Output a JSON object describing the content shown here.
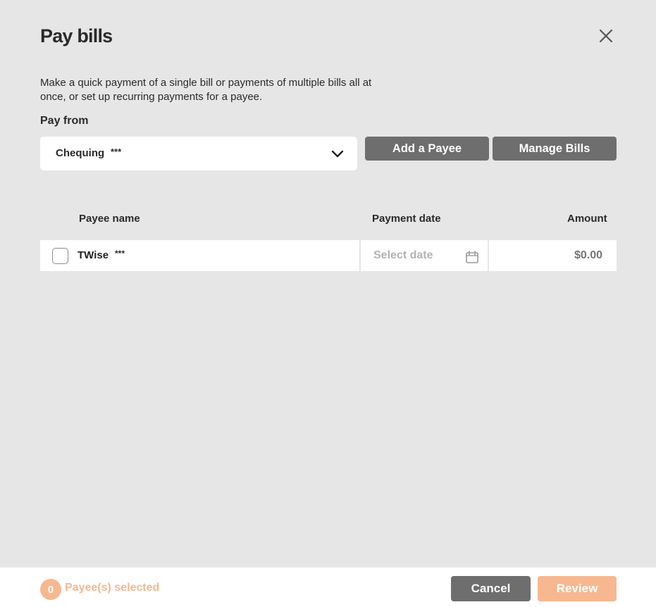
{
  "dialog": {
    "title": "Pay bills",
    "close_icon": "close-icon",
    "description": "Make a quick payment of a single bill or payments of multiple bills all at once, or set up recurring payments for a payee."
  },
  "pay_from": {
    "label": "Pay from",
    "selected_account": "Chequing",
    "account_mask": "***",
    "dropdown_icon": "chevron-down-icon"
  },
  "actions": {
    "add_payee_label": "Add a Payee",
    "manage_bills_label": "Manage Bills"
  },
  "table": {
    "headers": {
      "payee": "Payee name",
      "date": "Payment date",
      "amount": "Amount"
    },
    "rows": [
      {
        "checked": false,
        "payee_name": "TWise",
        "payee_mask": "***",
        "date_placeholder": "Select date",
        "date_icon": "calendar-icon",
        "amount_placeholder": "$0.00"
      }
    ]
  },
  "footer": {
    "selected_count": "0",
    "selected_label": "Payee(s) selected",
    "cancel_label": "Cancel",
    "review_label": "Review"
  },
  "colors": {
    "background": "#e6e6e6",
    "primary_gray": "#6e6e6e",
    "accent_orange_disabled": "#f7b890",
    "placeholder_gray": "#b3b3b3"
  }
}
